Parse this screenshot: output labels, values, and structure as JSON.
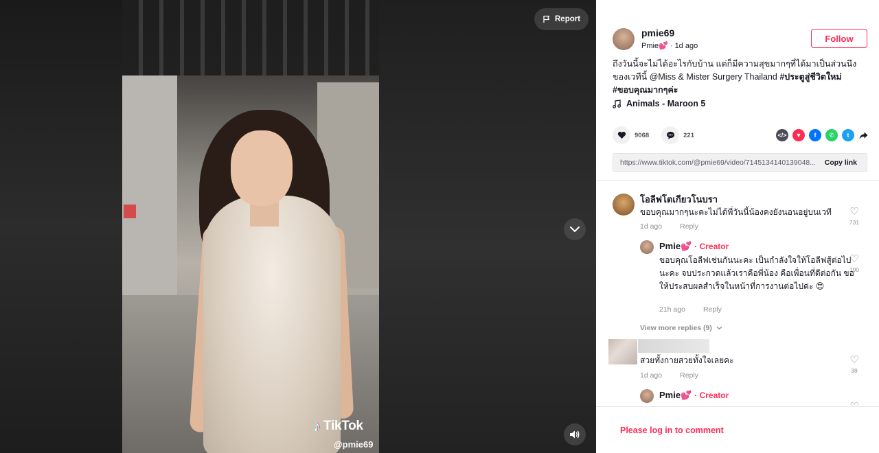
{
  "video": {
    "report_label": "Report",
    "watermark_text": "TikTok",
    "watermark_handle": "@pmie69"
  },
  "author": {
    "username": "pmie69",
    "nickname": "Pmie",
    "nickname_emoji": "💕",
    "posted": "1d ago",
    "follow_label": "Follow"
  },
  "post": {
    "caption_plain": "ถึงวันนี้จะไม่ได้อะไรกับบ้าน แต่ก็มีความสุขมากๆที่ได้มาเป็นส่วนนึงของเวทีนี้ @Miss & Mister Surgery Thailand",
    "hashtag_1": "#ประตูสู่ชีวิตใหม่",
    "hashtag_2": "#ขอบคุณมากๆค่ะ",
    "music": "Animals - Maroon 5",
    "likes": "9068",
    "comments_count": "221",
    "share_link": "https://www.tiktok.com/@pmie69/video/7145134140139048...",
    "copy_link_label": "Copy link"
  },
  "share_icons": [
    {
      "name": "embed-icon",
      "color": "#4d4d58",
      "glyph": "</>"
    },
    {
      "name": "friends-share-icon",
      "color": "#fe2c55",
      "glyph": "▼"
    },
    {
      "name": "facebook-icon",
      "color": "#0075fa",
      "glyph": "f"
    },
    {
      "name": "whatsapp-icon",
      "color": "#25d366",
      "glyph": "✆"
    },
    {
      "name": "twitter-icon",
      "color": "#1da1f2",
      "glyph": "t"
    }
  ],
  "comments": {
    "c1": {
      "name": "โอลีฟโตเกียวโนบรา",
      "text": "ขอบคุณมากๆนะคะไม่ได้พี่วันนี้น้องคงยังนอนอยู่บนเวที",
      "time": "1d ago",
      "reply": "Reply",
      "likes": "731"
    },
    "r1": {
      "name": "Pmie💕",
      "badge": "· Creator",
      "text": "ขอบคุณโอลีฟเช่นกันนะคะ เป็นกำลังใจให้โอลีฟสู้ต่อไปนะคะ จบประกวดแล้วเราคือพี่น้อง คือเพื่อนที่ดีต่อกัน ขอให้ประสบผลสำเร็จในหน้าที่การงานต่อไปค่ะ 😍",
      "time": "21h ago",
      "reply": "Reply",
      "likes": "190"
    },
    "view_more": "View more replies (9)",
    "c2": {
      "text": "สวยทั้งกายสวยทั้งใจเลยคะ",
      "time": "1d ago",
      "reply": "Reply",
      "likes": "38"
    },
    "r2": {
      "name": "Pmie💕",
      "badge": "· Creator"
    }
  },
  "login_prompt": "Please log in to comment",
  "colors": {
    "accent": "#fe2c55",
    "text": "#161823",
    "muted": "rgba(22,24,35,.5)"
  }
}
